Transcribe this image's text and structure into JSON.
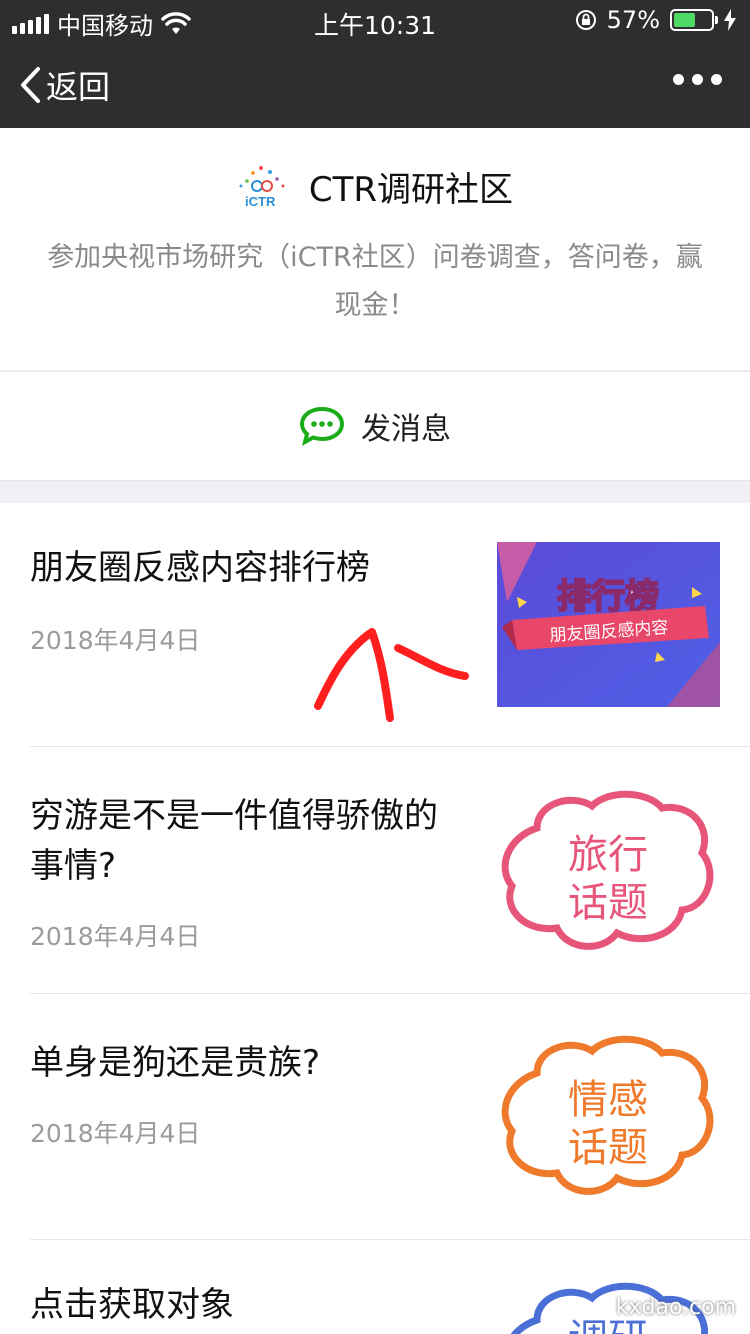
{
  "status_bar": {
    "carrier": "中国移动",
    "time": "上午10:31",
    "battery_percent": "57%",
    "battery_level": 0.57,
    "icons": [
      "signal-icon",
      "wifi-icon",
      "orientation-lock-icon",
      "battery-icon",
      "charging-icon"
    ]
  },
  "nav": {
    "back_label": "返回",
    "more_icon": "more-icon"
  },
  "account": {
    "logo_text": "iCTR",
    "name": "CTR调研社区",
    "description": "参加央视市场研究（iCTR社区）问卷调查，答问卷，赢现金！"
  },
  "message": {
    "label": "发消息",
    "icon": "chat-bubble-icon",
    "icon_color": "#1aad19"
  },
  "articles": [
    {
      "title": "朋友圈反感内容排行榜",
      "date": "2018年4月4日",
      "thumb_title": "排行榜",
      "thumb_sub": "朋友圈反感内容"
    },
    {
      "title": "穷游是不是一件值得骄傲的事情?",
      "date": "2018年4月4日",
      "thumb_line1": "旅行",
      "thumb_line2": "话题",
      "thumb_color": "#e8557a"
    },
    {
      "title": "单身是狗还是贵族?",
      "date": "2018年4月4日",
      "thumb_line1": "情感",
      "thumb_line2": "话题",
      "thumb_color": "#ef7a2c"
    },
    {
      "title": "点击获取对象",
      "thumb_line1": "调研",
      "thumb_color": "#4a70d8"
    }
  ],
  "watermark": "kxdao.com"
}
